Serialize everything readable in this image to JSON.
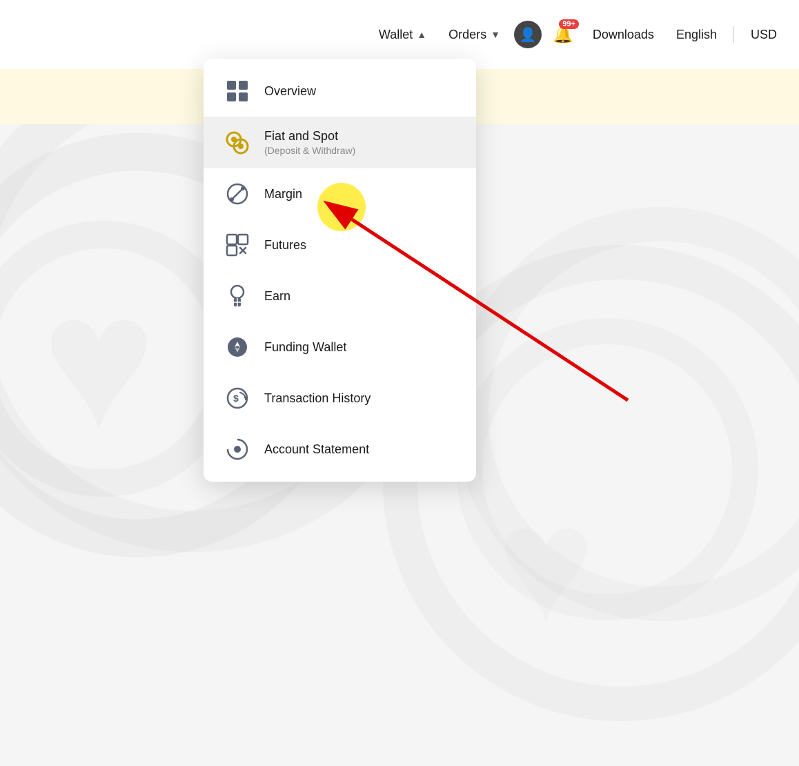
{
  "navbar": {
    "wallet_label": "Wallet",
    "orders_label": "Orders",
    "downloads_label": "Downloads",
    "lang_label": "English",
    "currency_label": "USD",
    "notification_badge": "99+"
  },
  "dropdown": {
    "items": [
      {
        "id": "overview",
        "label": "Overview",
        "sublabel": "",
        "icon": "overview-icon"
      },
      {
        "id": "fiat-spot",
        "label": "Fiat and Spot",
        "sublabel": "(Deposit & Withdraw)",
        "icon": "fiat-spot-icon"
      },
      {
        "id": "margin",
        "label": "Margin",
        "sublabel": "",
        "icon": "margin-icon"
      },
      {
        "id": "futures",
        "label": "Futures",
        "sublabel": "",
        "icon": "futures-icon"
      },
      {
        "id": "earn",
        "label": "Earn",
        "sublabel": "",
        "icon": "earn-icon"
      },
      {
        "id": "funding-wallet",
        "label": "Funding Wallet",
        "sublabel": "",
        "icon": "funding-wallet-icon"
      },
      {
        "id": "transaction-history",
        "label": "Transaction History",
        "sublabel": "",
        "icon": "transaction-history-icon"
      },
      {
        "id": "account-statement",
        "label": "Account Statement",
        "sublabel": "",
        "icon": "account-statement-icon"
      }
    ]
  }
}
